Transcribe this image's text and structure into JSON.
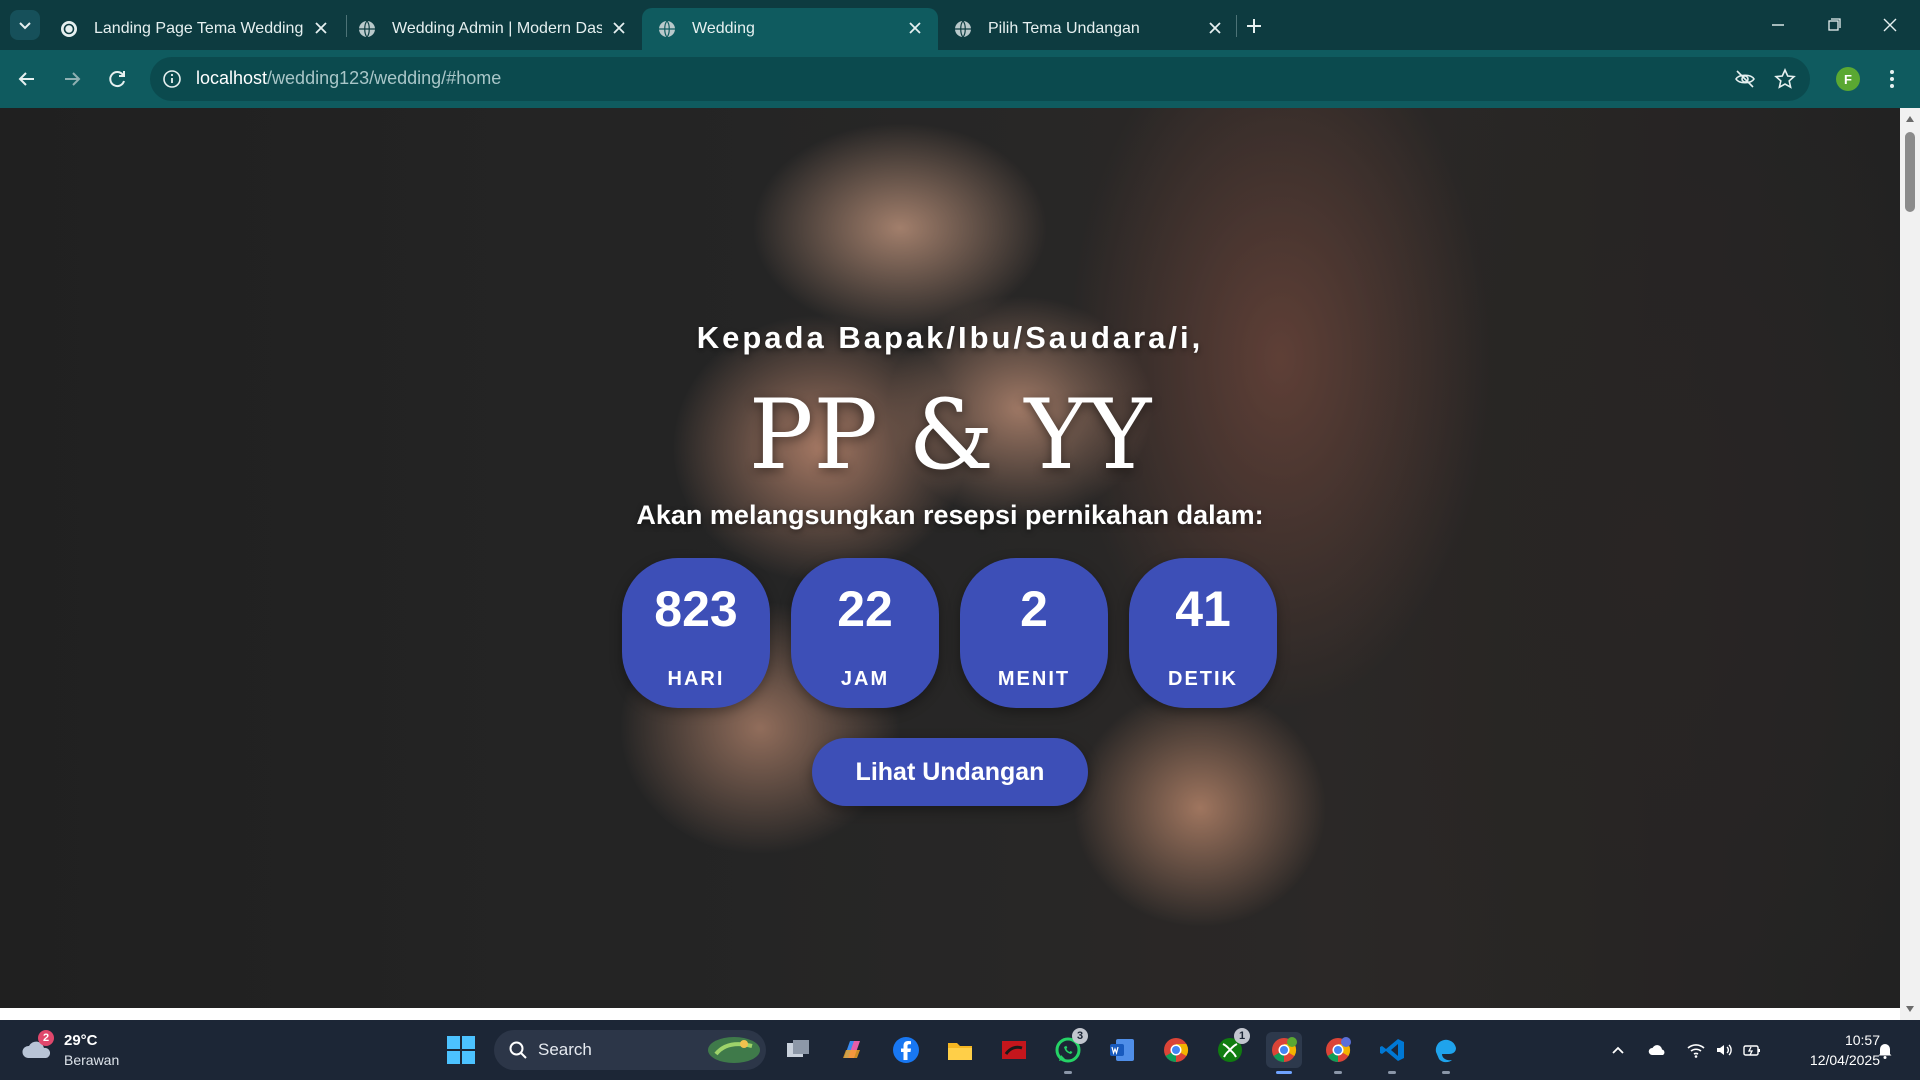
{
  "browser": {
    "tabs": [
      {
        "title": "Landing Page Tema Wedding",
        "active": false
      },
      {
        "title": "Wedding Admin | Modern Dash",
        "active": false
      },
      {
        "title": "Wedding",
        "active": true
      },
      {
        "title": "Pilih Tema Undangan",
        "active": false
      }
    ],
    "url_host": "localhost",
    "url_path": "/wedding123/wedding/#home",
    "profile_initial": "F"
  },
  "page": {
    "greeting": "Kepada Bapak/Ibu/Saudara/i,",
    "couple": "PP & YY",
    "subtitle": "Akan melangsungkan resepsi pernikahan dalam:",
    "countdown": [
      {
        "value": "823",
        "label": "HARI"
      },
      {
        "value": "22",
        "label": "JAM"
      },
      {
        "value": "2",
        "label": "MENIT"
      },
      {
        "value": "41",
        "label": "DETIK"
      }
    ],
    "cta_label": "Lihat Undangan",
    "accent_color": "#3d4fb7"
  },
  "taskbar": {
    "weather": {
      "temp": "29°C",
      "condition": "Berawan",
      "badge": "2"
    },
    "search_label": "Search",
    "apps": [
      {
        "name": "task-view",
        "badge": ""
      },
      {
        "name": "copilot",
        "badge": ""
      },
      {
        "name": "facebook",
        "badge": ""
      },
      {
        "name": "file-explorer",
        "badge": ""
      },
      {
        "name": "red-app",
        "badge": ""
      },
      {
        "name": "whatsapp",
        "badge": "3"
      },
      {
        "name": "word",
        "badge": ""
      },
      {
        "name": "chrome",
        "badge": ""
      },
      {
        "name": "xbox",
        "badge": "1"
      },
      {
        "name": "chrome-profile-f",
        "badge": ""
      },
      {
        "name": "chrome-profile-2",
        "badge": ""
      },
      {
        "name": "vscode",
        "badge": ""
      },
      {
        "name": "edge-app",
        "badge": ""
      }
    ],
    "time": "10:57",
    "date": "12/04/2025"
  }
}
